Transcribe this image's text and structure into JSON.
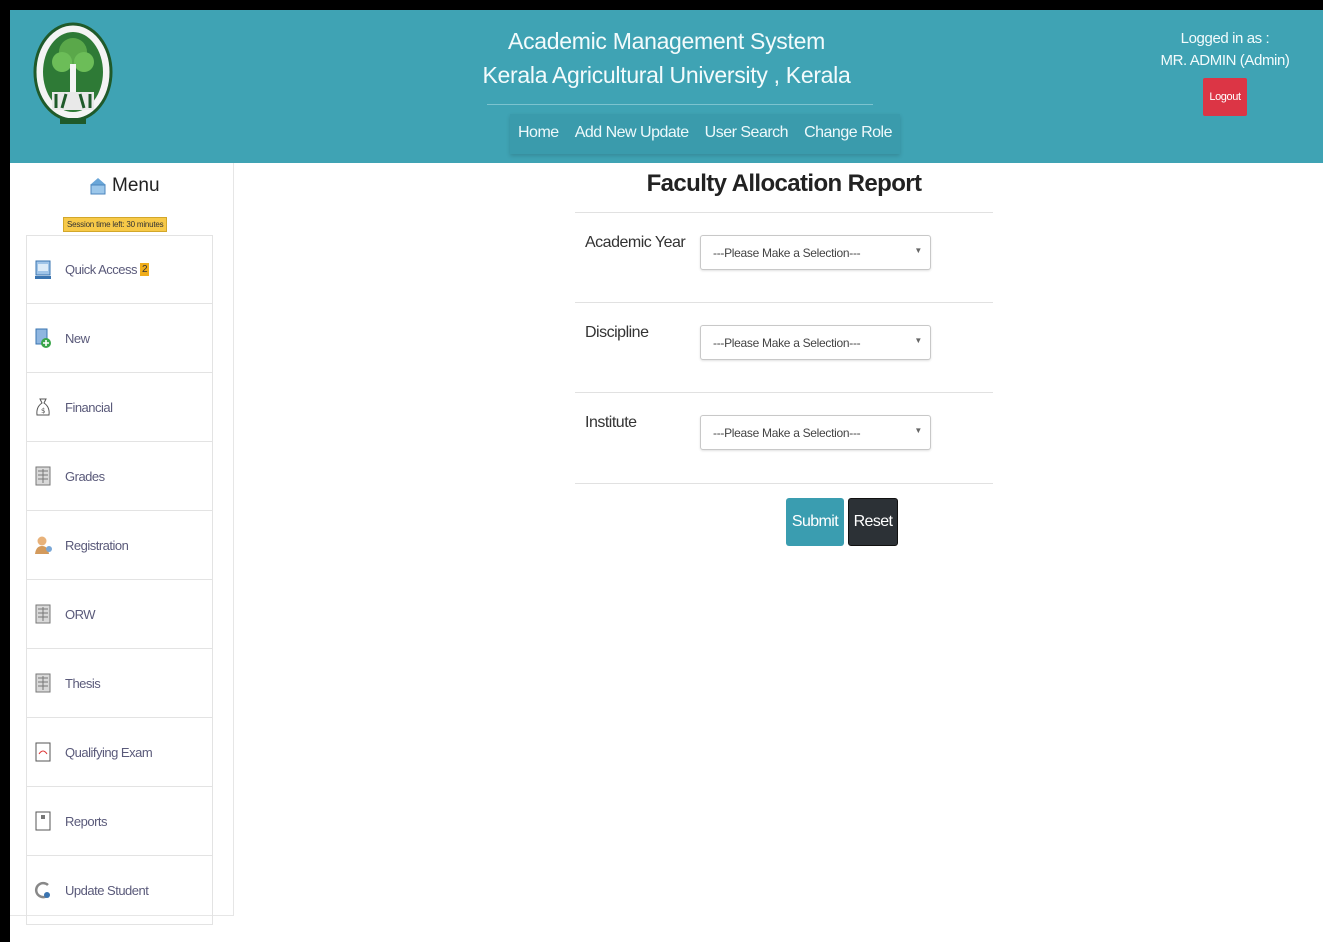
{
  "header": {
    "title_line1": "Academic Management System",
    "title_line2": "Kerala Agricultural University , Kerala",
    "nav": [
      "Home",
      "Add New Update",
      "User Search",
      "Change Role"
    ],
    "logged_in_label": "Logged in as :",
    "user": "MR. ADMIN (Admin)",
    "logout_label": "Logout"
  },
  "sidebar": {
    "menu_title": "Menu",
    "session_text": "Session time left: 30 minutes",
    "items": [
      {
        "label": "Quick Access",
        "badge": "2",
        "icon": "monitor-icon"
      },
      {
        "label": "New",
        "icon": "new-document-icon"
      },
      {
        "label": "Financial",
        "icon": "money-bag-icon"
      },
      {
        "label": "Grades",
        "icon": "grid-document-icon"
      },
      {
        "label": "Registration",
        "icon": "user-icon"
      },
      {
        "label": "ORW",
        "icon": "grid-document-icon"
      },
      {
        "label": "Thesis",
        "icon": "grid-document-icon"
      },
      {
        "label": "Qualifying Exam",
        "icon": "pdf-document-icon"
      },
      {
        "label": "Reports",
        "icon": "report-icon"
      },
      {
        "label": "Update Student",
        "icon": "refresh-icon"
      }
    ]
  },
  "form": {
    "heading": "Faculty Allocation Report",
    "fields": [
      {
        "label": "Academic Year",
        "value": "---Please Make a Selection---"
      },
      {
        "label": "Discipline",
        "value": "---Please Make a Selection---"
      },
      {
        "label": "Institute",
        "value": "---Please Make a Selection---"
      }
    ],
    "submit_label": "Submit",
    "reset_label": "Reset"
  },
  "colors": {
    "header_bg": "#3fa3b4",
    "logout_bg": "#dc3545",
    "submit_bg": "#3a9db0",
    "reset_bg": "#2c3136",
    "badge_bg": "#f0ad1b"
  }
}
